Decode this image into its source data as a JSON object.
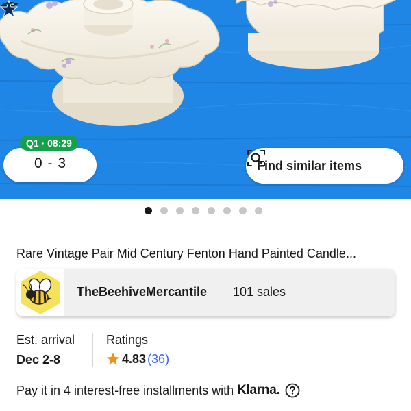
{
  "hero": {
    "image_alt": "Two white ruffled milk glass candle holders on a blue wooden surface",
    "background_color": "#1f86e6"
  },
  "score": {
    "time": "Q1 · 08:29",
    "score_text": "0 - 3",
    "team_a_icon": "seahawks-logo-icon",
    "team_b_icon": "cowboys-star-icon",
    "time_badge_color": "#15a14b"
  },
  "similar": {
    "label": "Find similar items",
    "icon": "visual-search-icon"
  },
  "carousel": {
    "total": 8,
    "active_index": 0
  },
  "listing": {
    "title": "Rare Vintage Pair Mid Century Fenton Hand Painted Candle..."
  },
  "seller": {
    "name": "TheBeehiveMercantile",
    "sales": "101 sales",
    "avatar_icon": "bee-logo-icon",
    "avatar_color": "#f6e25a"
  },
  "arrival": {
    "label": "Est. arrival",
    "value": "Dec 2-8"
  },
  "ratings": {
    "label": "Ratings",
    "value": "4.83",
    "count": "(36)",
    "star_color": "#f18f1f",
    "count_color": "#3665f3"
  },
  "payment": {
    "text": "Pay it in 4 interest-free installments with",
    "brand": "Klarna.",
    "help_icon": "help-circle-icon"
  }
}
